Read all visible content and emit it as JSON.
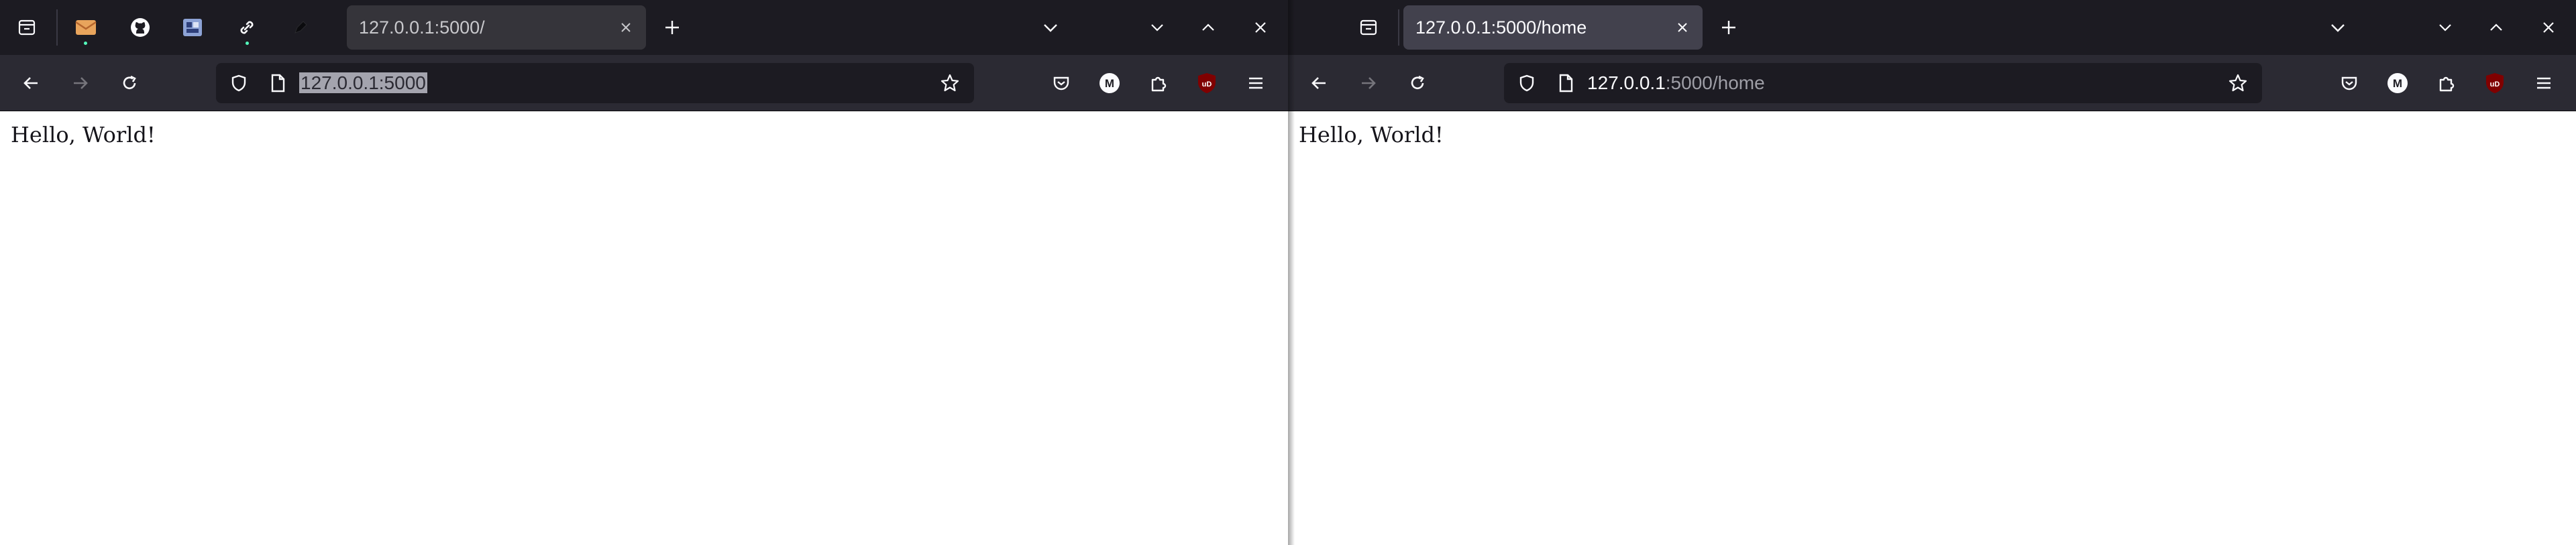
{
  "left_window": {
    "pinned_tabs": [
      "mail-icon",
      "github-icon",
      "app-icon",
      "link-icon",
      "pen-icon"
    ],
    "tab": {
      "title": "127.0.0.1:5000/",
      "active": false
    },
    "urlbar": {
      "value": "127.0.0.1:5000",
      "selected": true
    },
    "page": {
      "text": "Hello, World!"
    }
  },
  "right_window": {
    "tab": {
      "title": "127.0.0.1:5000/home",
      "active": true
    },
    "urlbar": {
      "host": "127.0.0.1",
      "rest": ":5000/home"
    },
    "page": {
      "text": "Hello, World!"
    }
  },
  "toolbar_extensions": {
    "ublock_label": "uD",
    "account_label": "M"
  },
  "colors": {
    "tabbar": "#1c1b22",
    "navbar": "#2b2a33",
    "active_tab": "#42414d",
    "inactive_tab": "#35343a",
    "icon": "#fbfbfe",
    "ublock": "#800000"
  }
}
